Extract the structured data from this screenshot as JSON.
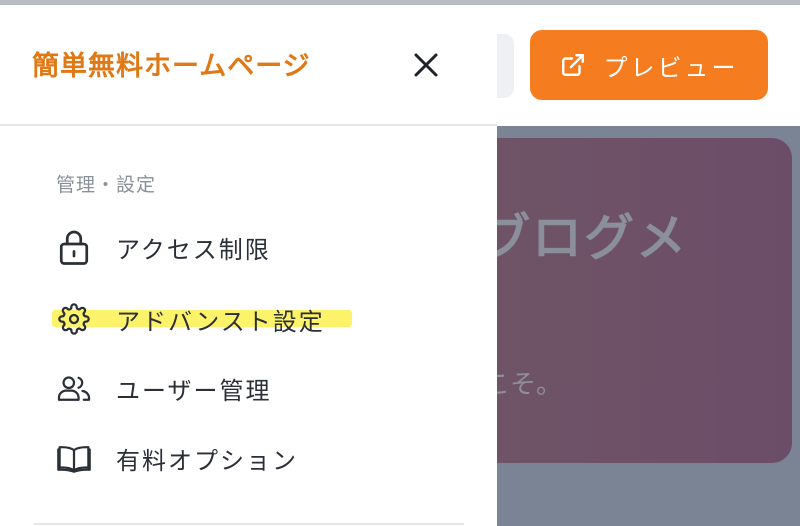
{
  "header": {
    "preview_label": "プレビュー",
    "preview_icon": "external-link-icon"
  },
  "hero": {
    "title_fragment": "ブログメ",
    "subtitle_fragment": "こそ。"
  },
  "drawer": {
    "brand": "簡単無料ホームページ",
    "close_icon": "close-icon",
    "section_label": "管理・設定",
    "items": [
      {
        "label": "アクセス制限",
        "icon": "lock-icon"
      },
      {
        "label": "アドバンスト設定",
        "icon": "gear-icon",
        "highlighted": true
      },
      {
        "label": "ユーザー管理",
        "icon": "users-icon"
      },
      {
        "label": "有料オプション",
        "icon": "book-icon"
      }
    ]
  },
  "colors": {
    "brand": "#e07816",
    "preview_button": "#f57c1f",
    "highlight": "#fcf36a",
    "overlay": "#7b8495"
  }
}
